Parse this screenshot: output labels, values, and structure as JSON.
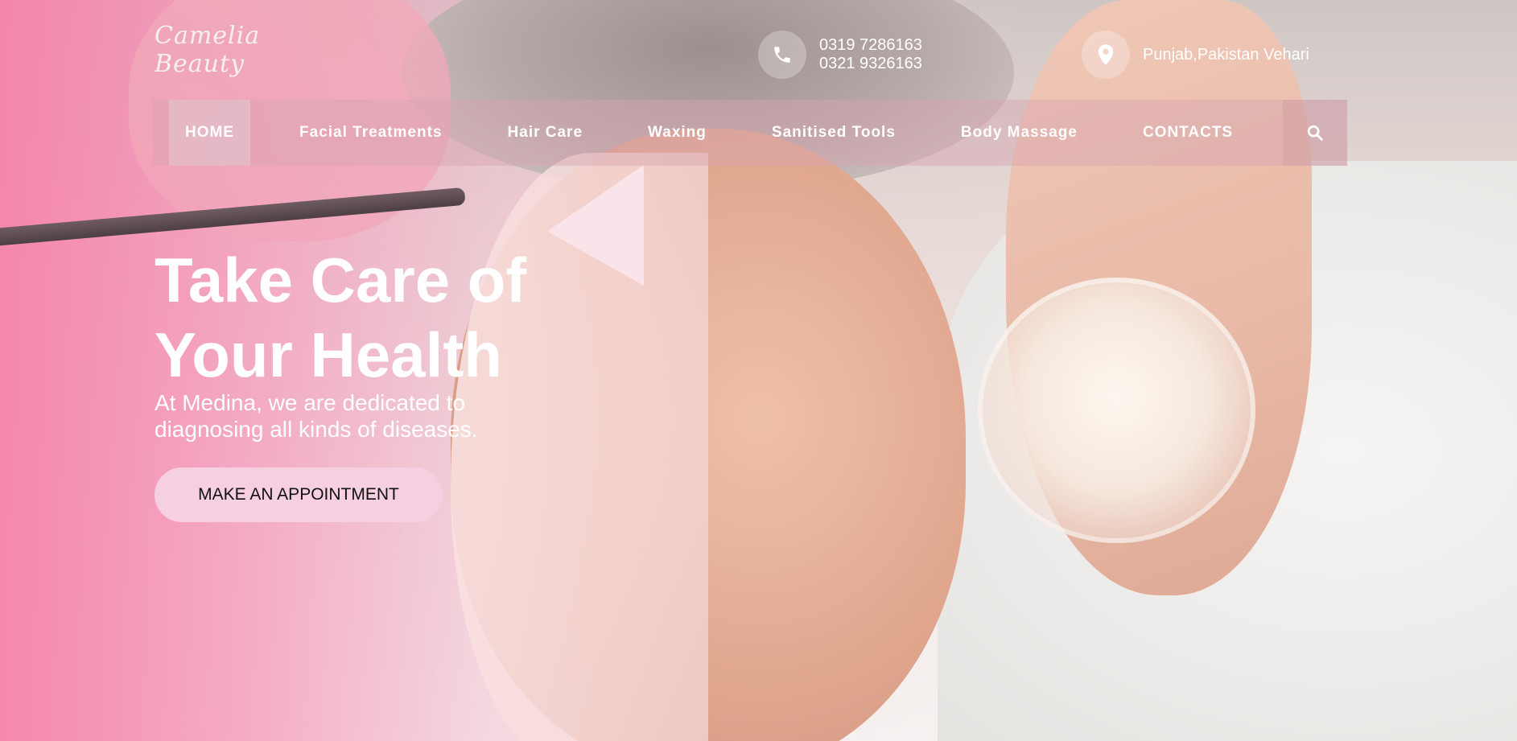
{
  "brand": {
    "logo_text": "Camelia Beauty"
  },
  "contact": {
    "phone_lines": [
      "0319 7286163",
      "0321 9326163"
    ],
    "location": "Punjab,Pakistan Vehari"
  },
  "nav": {
    "items": [
      {
        "label": "HOME",
        "active": true
      },
      {
        "label": "Facial Treatments"
      },
      {
        "label": "Hair Care"
      },
      {
        "label": "Waxing"
      },
      {
        "label": "Sanitised Tools"
      },
      {
        "label": "Body Massage"
      },
      {
        "label": "CONTACTS"
      }
    ],
    "search_icon": "search-icon"
  },
  "hero": {
    "title_line1": "Take Care of",
    "title_line2": "Your Health",
    "subtitle_line1": "At Medina, we are dedicated to",
    "subtitle_line2": "diagnosing all kinds of diseases.",
    "cta_label": "MAKE AN APPOINTMENT"
  },
  "colors": {
    "accent_pink": "#f6cfe0",
    "overlay_pink": "#f582aa"
  }
}
